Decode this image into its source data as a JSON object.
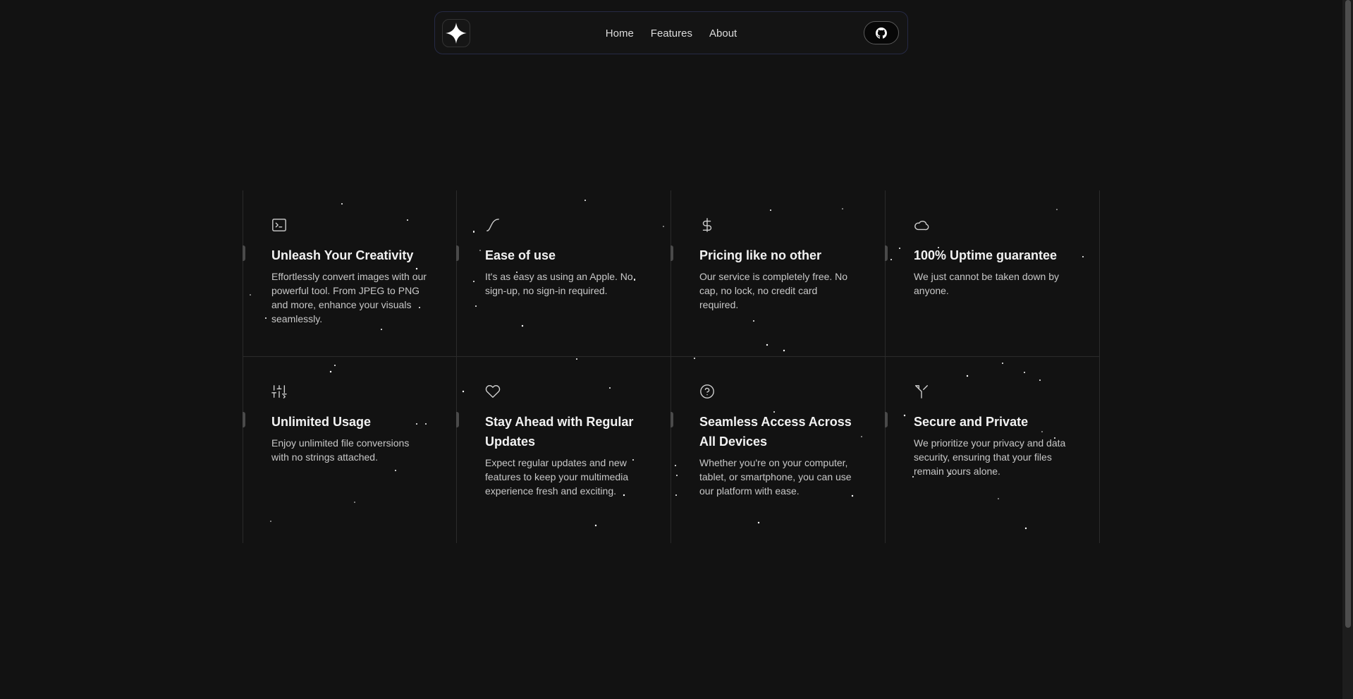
{
  "nav": {
    "logo": "sparkle-logo",
    "links": [
      "Home",
      "Features",
      "About"
    ],
    "github": "github-icon"
  },
  "features": [
    {
      "icon": "terminal-icon",
      "title": "Unleash Your Creativity",
      "description": "Effortlessly convert images with our powerful tool. From JPEG to PNG and more, enhance your visuals seamlessly."
    },
    {
      "icon": "curve-icon",
      "title": "Ease of use",
      "description": "It's as easy as using an Apple. No sign-up, no sign-in required."
    },
    {
      "icon": "dollar-icon",
      "title": "Pricing like no other",
      "description": "Our service is completely free. No cap, no lock, no credit card required."
    },
    {
      "icon": "cloud-icon",
      "title": "100% Uptime guarantee",
      "description": "We just cannot be taken down by anyone."
    },
    {
      "icon": "sliders-icon",
      "title": "Unlimited Usage",
      "description": "Enjoy unlimited file conversions with no strings attached."
    },
    {
      "icon": "heart-icon",
      "title": "Stay Ahead with Regular Updates",
      "description": "Expect regular updates and new features to keep your multimedia experience fresh and exciting."
    },
    {
      "icon": "help-circle-icon",
      "title": "Seamless Access Across All Devices",
      "description": "Whether you're on your computer, tablet, or smartphone, you can use our platform with ease."
    },
    {
      "icon": "route-icon",
      "title": "Secure and Private",
      "description": "We prioritize your privacy and data security, ensuring that your files remain yours alone."
    }
  ]
}
